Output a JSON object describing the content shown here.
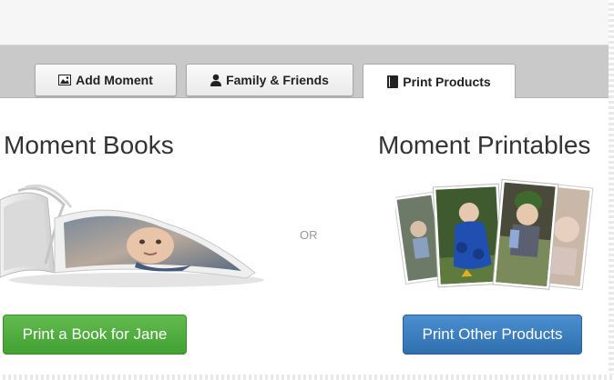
{
  "tabs": {
    "add_moment": {
      "label": "Add Moment",
      "icon": "image-icon"
    },
    "family_friends": {
      "label": "Family & Friends",
      "icon": "person-icon"
    },
    "print_products": {
      "label": "Print Products",
      "icon": "book-icon",
      "active": true
    }
  },
  "main": {
    "books_heading": "Moment Books",
    "printables_heading": "Moment Printables",
    "or_label": "OR",
    "book_button_label": "Print a Book for Jane",
    "print_button_label": "Print Other Products"
  },
  "colors": {
    "book_button": "#4cae3d",
    "print_button": "#3b7fc0",
    "tab_strip": "#c9c9c9"
  }
}
